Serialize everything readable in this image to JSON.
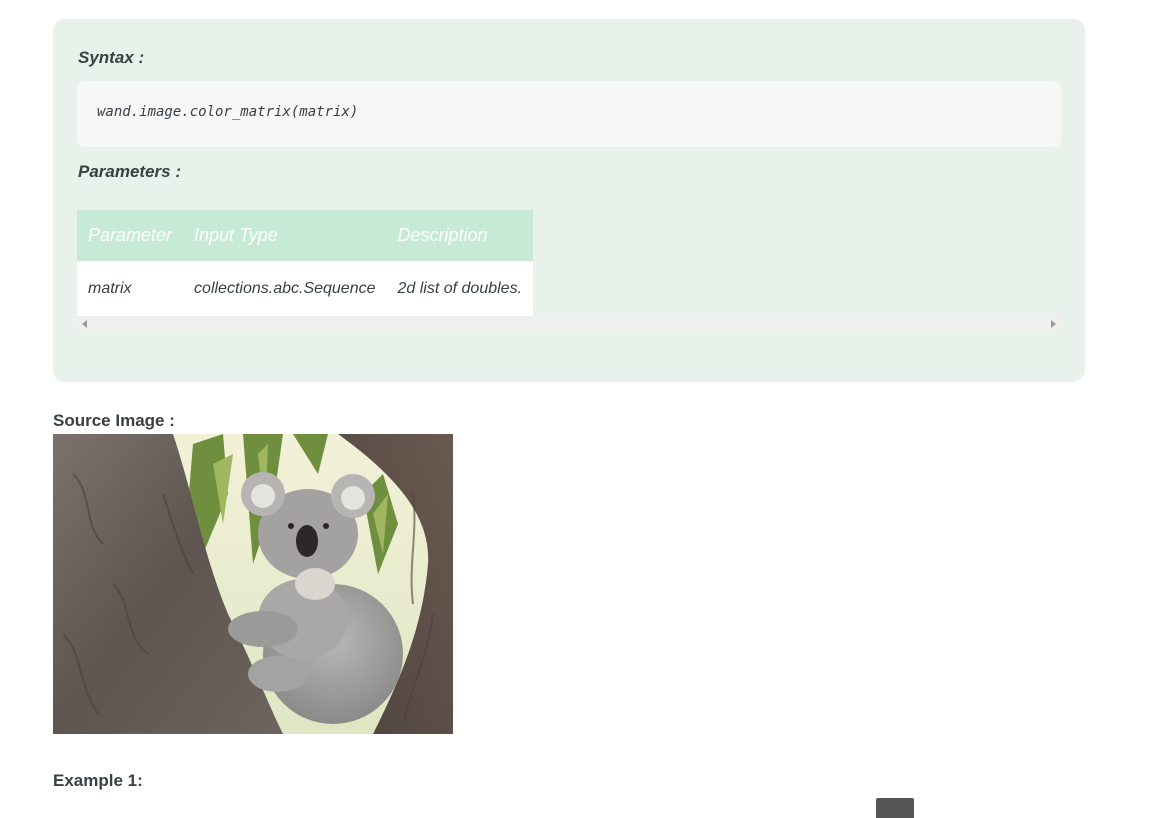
{
  "syntax": {
    "title": "Syntax :",
    "code": "wand.image.color_matrix(matrix)"
  },
  "parameters": {
    "title": "Parameters :",
    "headers": [
      "Parameter",
      "Input Type",
      "Description"
    ],
    "rows": [
      [
        "matrix",
        "collections.abc.Sequence",
        "2d list of doubles."
      ]
    ]
  },
  "source_image": {
    "heading": "Source Image :",
    "icon": "koala-photo"
  },
  "example": {
    "heading": "Example 1:"
  },
  "colors": {
    "box_background": "#e8f2ea",
    "table_header": "#c7ead6",
    "code_background": "#f7f7f7",
    "text": "#3a3f44"
  }
}
